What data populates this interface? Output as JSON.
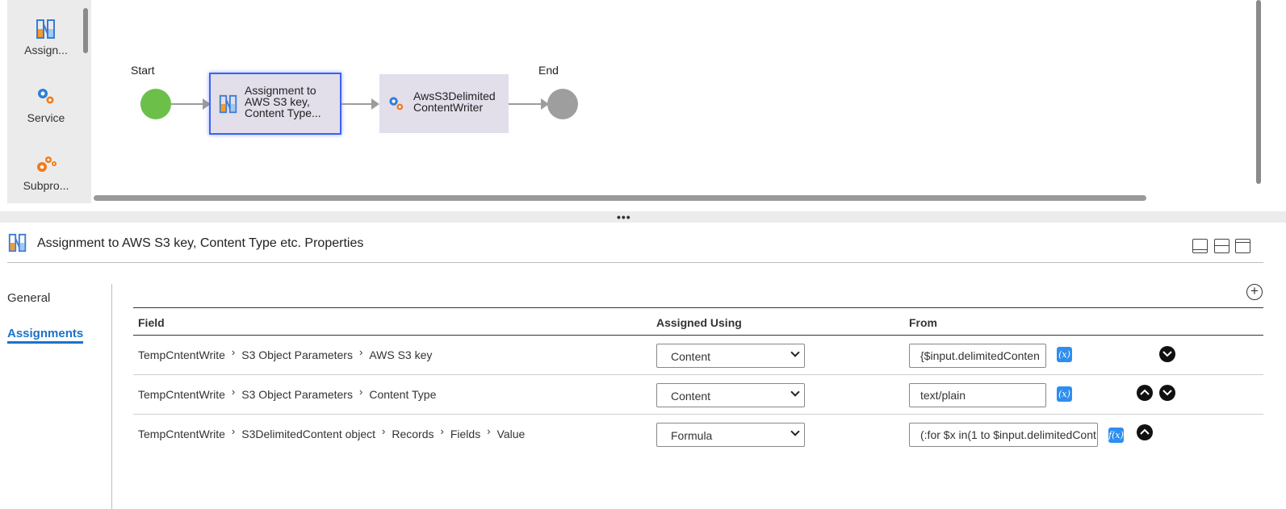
{
  "palette": {
    "items": [
      {
        "label": "Assign...",
        "icon": "assignment-icon"
      },
      {
        "label": "Service",
        "icon": "service-gears-icon"
      },
      {
        "label": "Subpro...",
        "icon": "subprocess-gears-icon"
      }
    ]
  },
  "flow": {
    "start_label": "Start",
    "end_label": "End",
    "steps": [
      {
        "line1": "Assignment to",
        "line2": "AWS S3 key,",
        "line3": "Content Type...",
        "icon": "assignment-icon"
      },
      {
        "line1": "AwsS3Delimited",
        "line2": "ContentWriter",
        "icon": "service-gears-icon"
      }
    ],
    "colors": {
      "start": "#6cc04a",
      "end": "#9e9e9e",
      "step_bg": "#e2deea",
      "selected_border": "#3b63f2"
    }
  },
  "divider": {
    "handle": "•••"
  },
  "properties": {
    "title": "Assignment to AWS S3 key, Content Type etc. Properties",
    "nav": {
      "general": "General",
      "assignments": "Assignments"
    },
    "add_label": "+",
    "columns": {
      "field": "Field",
      "assigned_using": "Assigned Using",
      "from": "From"
    },
    "rows": [
      {
        "path": [
          "TempCntentWrite",
          "S3 Object Parameters",
          "AWS S3 key"
        ],
        "assigned_using": "Content",
        "from": "{$input.delimitedConten",
        "fx_label": "(x)"
      },
      {
        "path": [
          "TempCntentWrite",
          "S3 Object Parameters",
          "Content Type"
        ],
        "assigned_using": "Content",
        "from": "text/plain",
        "fx_label": "(x)"
      },
      {
        "path": [
          "TempCntentWrite",
          "S3DelimitedContent object",
          "Records",
          "Fields",
          "Value"
        ],
        "assigned_using": "Formula",
        "from": "(:for $x in(1 to $input.delimitedCont",
        "fx_label": "f(x)"
      }
    ],
    "accent_color": "#1a73c8"
  }
}
